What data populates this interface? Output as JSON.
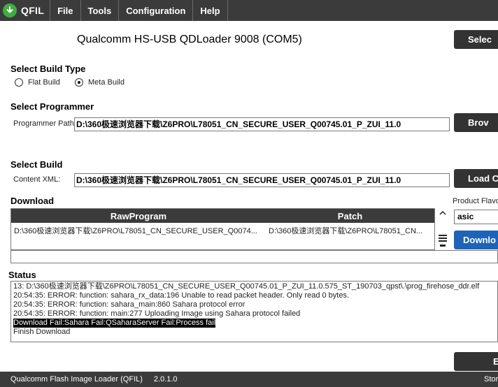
{
  "app": {
    "name": "QFIL",
    "menu": [
      "File",
      "Tools",
      "Configuration",
      "Help"
    ]
  },
  "device": {
    "port_label": "Qualcomm HS-USB QDLoader 9008 (COM5)",
    "select_port_button": "Selec"
  },
  "build_type": {
    "heading": "Select Build Type",
    "options": [
      {
        "label": "Flat Build",
        "selected": false
      },
      {
        "label": "Meta Build",
        "selected": true
      }
    ]
  },
  "programmer": {
    "heading": "Select Programmer",
    "path_label": "Programmer Path",
    "path_value": "D:\\360极速浏览器下载\\Z6PRO\\L78051_CN_SECURE_USER_Q00745.01_P_ZUI_11.0",
    "browse_button": "Brov"
  },
  "build": {
    "heading": "Select Build",
    "content_label": "Content XML:",
    "content_value": "D:\\360极速浏览器下载\\Z6PRO\\L78051_CN_SECURE_USER_Q00745.01_P_ZUI_11.0",
    "load_button": "Load C"
  },
  "download": {
    "heading": "Download",
    "columns": [
      "RawProgram",
      "Patch"
    ],
    "rows": [
      [
        "D:\\360极速浏览器下载\\Z6PRO\\L78051_CN_SECURE_USER_Q0074...",
        "D:\\360极速浏览器下载\\Z6PRO\\L78051_CN..."
      ]
    ],
    "product_flavor_label": "Product Flavo",
    "product_flavor_value": "asic",
    "download_button": "Downlo"
  },
  "status": {
    "heading": "Status",
    "lines": [
      "13: D:\\360极速浏览器下载\\Z6PRO\\L78051_CN_SECURE_USER_Q00745.01_P_ZUI_11.0.575_ST_190703_qpst\\.\\prog_firehose_ddr.elf",
      "20:54:35: ERROR: function: sahara_rx_data:196 Unable to read packet header. Only read 0 bytes.",
      "20:54:35: ERROR: function: sahara_main:860 Sahara protocol error",
      "20:54:35: ERROR: function: main:277 Uploading  Image using Sahara protocol failed",
      "Download Fail:Sahara Fail:QSaharaServer Fail:Process fail",
      "Finish Download"
    ],
    "highlighted_line_index": 4
  },
  "exit_button": "E",
  "footer": {
    "app_full_name": "Qualcomm Flash Image Loader (QFIL)",
    "version": "2.0.1.0",
    "storage_label": "Stor"
  },
  "colors": {
    "bar_bg": "#3b3b3b",
    "accent_blue": "#1e63b8",
    "logo_green": "#3fae3f"
  }
}
